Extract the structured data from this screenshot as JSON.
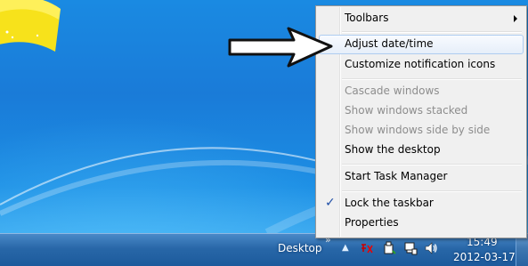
{
  "context_menu": {
    "items": [
      {
        "label": "Toolbars",
        "enabled": true,
        "submenu": true
      },
      {
        "label": "Adjust date/time",
        "enabled": true,
        "highlighted": true
      },
      {
        "label": "Customize notification icons",
        "enabled": true
      },
      {
        "label": "Cascade windows",
        "enabled": false
      },
      {
        "label": "Show windows stacked",
        "enabled": false
      },
      {
        "label": "Show windows side by side",
        "enabled": false
      },
      {
        "label": "Show the desktop",
        "enabled": true
      },
      {
        "label": "Start Task Manager",
        "enabled": true
      },
      {
        "label": "Lock the taskbar",
        "enabled": true,
        "checked": true
      },
      {
        "label": "Properties",
        "enabled": true
      }
    ],
    "check_glyph": "✓"
  },
  "taskbar": {
    "toolbar_label": "Desktop",
    "chevron": "»",
    "tray_expand": "▲",
    "time": "15:49",
    "date": "2012-03-17"
  },
  "icons": [
    "windows-logo-icon",
    "annotation-arrow-icon",
    "network-error-icon",
    "safely-remove-hardware-icon",
    "action-center-icon",
    "volume-icon",
    "submenu-arrow-icon",
    "checkmark-icon"
  ],
  "colors": {
    "desktop_blue": "#1a7bd8",
    "taskbar_blue": "#2867a8",
    "menu_background": "#f0f0f0",
    "highlight_border": "#aeccf0",
    "disabled_text": "#8d8d8d"
  }
}
